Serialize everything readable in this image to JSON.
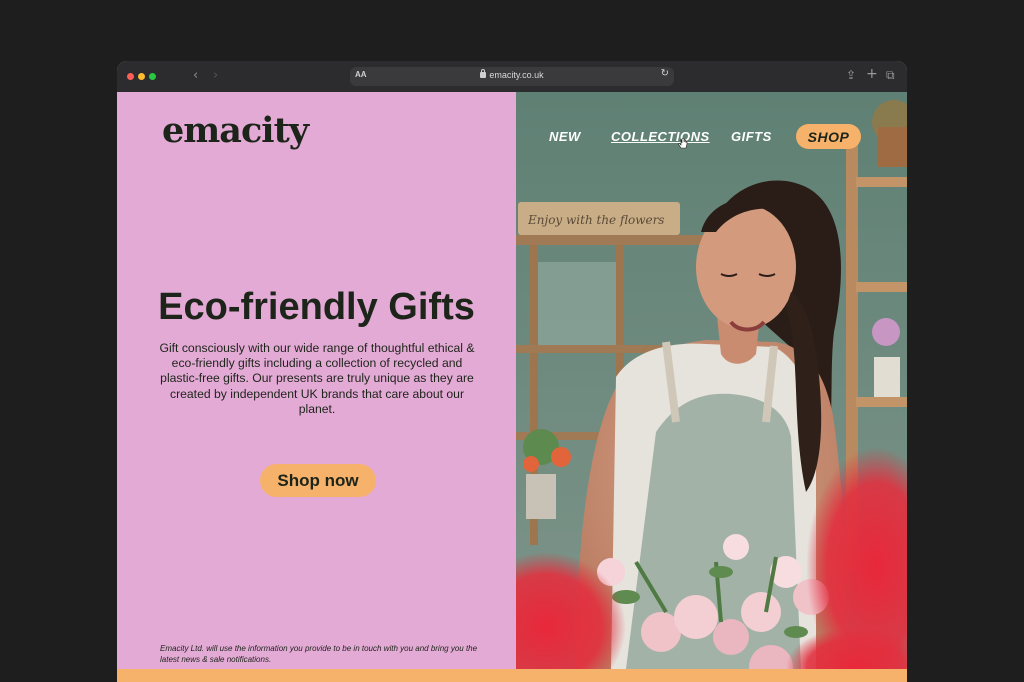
{
  "browser": {
    "url": "emacity.co.uk",
    "reader_label": "AA"
  },
  "site": {
    "logo": "emacity",
    "nav": [
      "NEW",
      "COLLECTIONS",
      "GIFTS",
      "SHOP"
    ],
    "headline": "Eco-friendly Gifts",
    "body": "Gift consciously with our wide range of thoughtful ethical & eco-friendly gifts including a collection of recycled and plastic-free gifts. Our presents are truly unique as they are created by independent UK brands that care about our planet.",
    "cta": "Shop now",
    "disclaimer": "Emacity Ltd. will use the information you provide to be in touch with you and bring you the latest news & sale notifications.",
    "photo_sign": "Enjoy with the flowers"
  },
  "colors": {
    "page_bg": "#1e1e1e",
    "hero_pink": "#e3aad6",
    "accent_orange": "#f6b26b",
    "text_dark": "#1d2419"
  },
  "icons": [
    "back-icon",
    "forward-icon",
    "lock-icon",
    "reload-icon",
    "share-icon",
    "new-tab-icon",
    "tabs-overview-icon",
    "pointer-cursor-icon"
  ]
}
